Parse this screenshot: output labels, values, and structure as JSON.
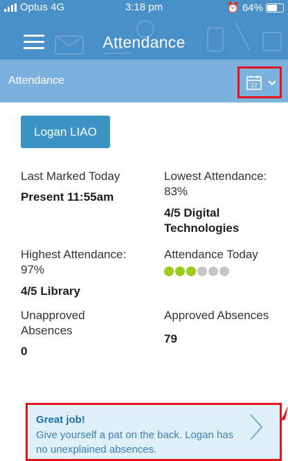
{
  "status_bar": {
    "carrier": "Optus 4G",
    "time": "3:18 pm",
    "battery": "64%"
  },
  "nav": {
    "title": "Attendance",
    "menu_icon": "hamburger-menu-icon"
  },
  "subheader": {
    "label": "Attendance",
    "calendar_day": "17",
    "calendar_icon": "calendar-icon",
    "chevron_icon": "chevron-down-icon"
  },
  "student_button": "Logan LIAO",
  "stats": {
    "last_marked": {
      "label": "Last Marked Today",
      "value": "Present 11:55am"
    },
    "lowest": {
      "label": "Lowest Attendance: 83%",
      "value": "4/5 Digital Technologies"
    },
    "highest": {
      "label": "Highest Attendance: 97%",
      "value": "4/5 Library"
    },
    "today": {
      "label": "Attendance Today",
      "periods_present": 3,
      "periods_total": 6
    },
    "unapproved": {
      "label": "Unapproved Absences",
      "value": "0"
    },
    "approved": {
      "label": "Approved Absences",
      "value": "79"
    }
  },
  "banner": {
    "title": "Great job!",
    "message": "Give yourself a pat on the back. Logan has no unexplained absences."
  },
  "colors": {
    "nav": "#4a90c8",
    "subheader": "#7db1dd",
    "button": "#3c93c6",
    "present_dot": "#9ccc1c",
    "absent_dot": "#c6c6c6",
    "highlight": "#e1141a",
    "banner_bg": "#dff0f8"
  }
}
